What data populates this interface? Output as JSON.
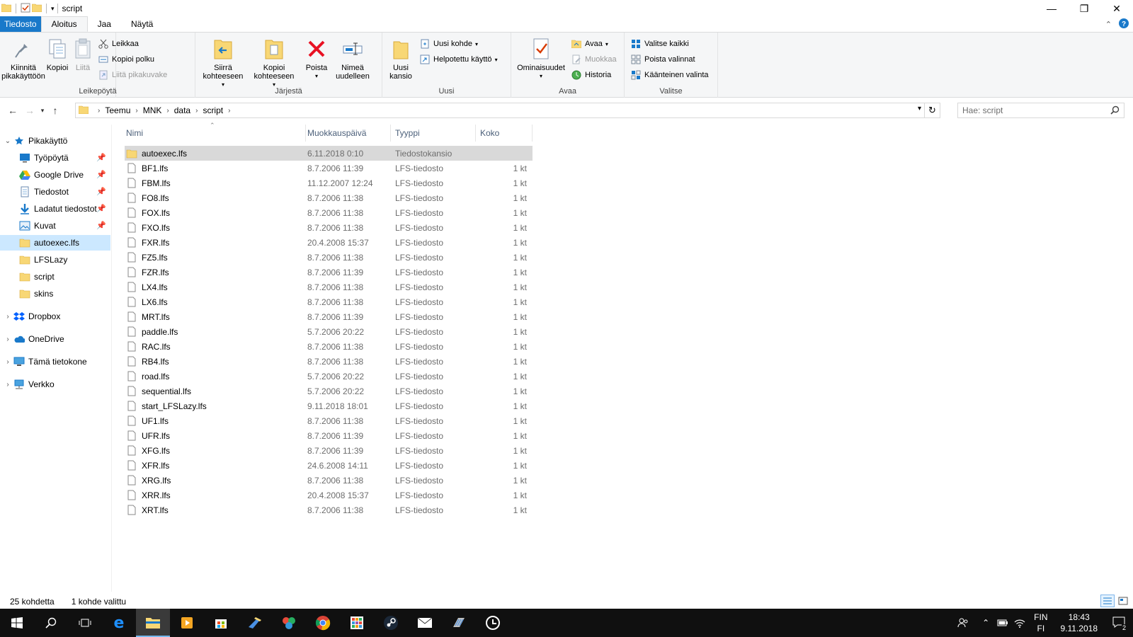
{
  "window": {
    "title": "script",
    "controls": {
      "minimize": "—",
      "restore": "❐",
      "close": "✕"
    }
  },
  "tabs": [
    {
      "label": "Tiedosto"
    },
    {
      "label": "Aloitus"
    },
    {
      "label": "Jaa"
    },
    {
      "label": "Näytä"
    }
  ],
  "ribbon": {
    "clipboard": {
      "label": "Leikepöytä",
      "pin": "Kiinnitä pikakäyttöön",
      "copy": "Kopioi",
      "paste": "Liitä",
      "cut": "Leikkaa",
      "copy_path": "Kopioi polku",
      "paste_shortcut": "Liitä pikakuvake"
    },
    "organize": {
      "label": "Järjestä",
      "move_to": "Siirrä kohteeseen",
      "copy_to": "Kopioi kohteeseen",
      "delete": "Poista",
      "rename": "Nimeä uudelleen"
    },
    "new": {
      "label": "Uusi",
      "new_folder": "Uusi kansio",
      "new_item": "Uusi kohde",
      "easy_access": "Helpotettu käyttö"
    },
    "open": {
      "label": "Avaa",
      "properties": "Ominaisuudet",
      "open": "Avaa",
      "edit": "Muokkaa",
      "history": "Historia"
    },
    "select": {
      "label": "Valitse",
      "select_all": "Valitse kaikki",
      "select_none": "Poista valinnat",
      "invert": "Käänteinen valinta"
    }
  },
  "address": {
    "crumbs": [
      "Teemu",
      "MNK",
      "data",
      "script"
    ],
    "search_placeholder": "Hae: script"
  },
  "nav": {
    "quick_access": "Pikakäyttö",
    "pinned": [
      {
        "label": "Työpöytä",
        "icon": "desktop-icon"
      },
      {
        "label": "Google Drive",
        "icon": "google-drive-icon"
      },
      {
        "label": "Tiedostot",
        "icon": "documents-icon"
      },
      {
        "label": "Ladatut tiedostot",
        "icon": "downloads-icon"
      },
      {
        "label": "Kuvat",
        "icon": "pictures-icon"
      }
    ],
    "recent": [
      {
        "label": "autoexec.lfs"
      },
      {
        "label": "LFSLazy"
      },
      {
        "label": "script"
      },
      {
        "label": "skins"
      }
    ],
    "roots": [
      {
        "label": "Dropbox"
      },
      {
        "label": "OneDrive"
      },
      {
        "label": "Tämä tietokone"
      },
      {
        "label": "Verkko"
      }
    ]
  },
  "columns": {
    "name": "Nimi",
    "modified": "Muokkauspäivä",
    "type": "Tyyppi",
    "size": "Koko"
  },
  "files": [
    {
      "name": "autoexec.lfs",
      "date": "6.11.2018 0:10",
      "type": "Tiedostokansio",
      "size": "",
      "folder": true
    },
    {
      "name": "BF1.lfs",
      "date": "8.7.2006 11:39",
      "type": "LFS-tiedosto",
      "size": "1 kt"
    },
    {
      "name": "FBM.lfs",
      "date": "11.12.2007 12:24",
      "type": "LFS-tiedosto",
      "size": "1 kt"
    },
    {
      "name": "FO8.lfs",
      "date": "8.7.2006 11:38",
      "type": "LFS-tiedosto",
      "size": "1 kt"
    },
    {
      "name": "FOX.lfs",
      "date": "8.7.2006 11:38",
      "type": "LFS-tiedosto",
      "size": "1 kt"
    },
    {
      "name": "FXO.lfs",
      "date": "8.7.2006 11:38",
      "type": "LFS-tiedosto",
      "size": "1 kt"
    },
    {
      "name": "FXR.lfs",
      "date": "20.4.2008 15:37",
      "type": "LFS-tiedosto",
      "size": "1 kt"
    },
    {
      "name": "FZ5.lfs",
      "date": "8.7.2006 11:38",
      "type": "LFS-tiedosto",
      "size": "1 kt"
    },
    {
      "name": "FZR.lfs",
      "date": "8.7.2006 11:39",
      "type": "LFS-tiedosto",
      "size": "1 kt"
    },
    {
      "name": "LX4.lfs",
      "date": "8.7.2006 11:38",
      "type": "LFS-tiedosto",
      "size": "1 kt"
    },
    {
      "name": "LX6.lfs",
      "date": "8.7.2006 11:38",
      "type": "LFS-tiedosto",
      "size": "1 kt"
    },
    {
      "name": "MRT.lfs",
      "date": "8.7.2006 11:39",
      "type": "LFS-tiedosto",
      "size": "1 kt"
    },
    {
      "name": "paddle.lfs",
      "date": "5.7.2006 20:22",
      "type": "LFS-tiedosto",
      "size": "1 kt"
    },
    {
      "name": "RAC.lfs",
      "date": "8.7.2006 11:38",
      "type": "LFS-tiedosto",
      "size": "1 kt"
    },
    {
      "name": "RB4.lfs",
      "date": "8.7.2006 11:38",
      "type": "LFS-tiedosto",
      "size": "1 kt"
    },
    {
      "name": "road.lfs",
      "date": "5.7.2006 20:22",
      "type": "LFS-tiedosto",
      "size": "1 kt"
    },
    {
      "name": "sequential.lfs",
      "date": "5.7.2006 20:22",
      "type": "LFS-tiedosto",
      "size": "1 kt"
    },
    {
      "name": "start_LFSLazy.lfs",
      "date": "9.11.2018 18:01",
      "type": "LFS-tiedosto",
      "size": "1 kt"
    },
    {
      "name": "UF1.lfs",
      "date": "8.7.2006 11:38",
      "type": "LFS-tiedosto",
      "size": "1 kt"
    },
    {
      "name": "UFR.lfs",
      "date": "8.7.2006 11:39",
      "type": "LFS-tiedosto",
      "size": "1 kt"
    },
    {
      "name": "XFG.lfs",
      "date": "8.7.2006 11:39",
      "type": "LFS-tiedosto",
      "size": "1 kt"
    },
    {
      "name": "XFR.lfs",
      "date": "24.6.2008 14:11",
      "type": "LFS-tiedosto",
      "size": "1 kt"
    },
    {
      "name": "XRG.lfs",
      "date": "8.7.2006 11:38",
      "type": "LFS-tiedosto",
      "size": "1 kt"
    },
    {
      "name": "XRR.lfs",
      "date": "20.4.2008 15:37",
      "type": "LFS-tiedosto",
      "size": "1 kt"
    },
    {
      "name": "XRT.lfs",
      "date": "8.7.2006 11:38",
      "type": "LFS-tiedosto",
      "size": "1 kt"
    }
  ],
  "status": {
    "count": "25 kohdetta",
    "selected": "1 kohde valittu"
  },
  "taskbar": {
    "lang_top": "FIN",
    "lang_bottom": "FI",
    "time": "18:43",
    "date": "9.11.2018",
    "notifications": "2"
  },
  "colors": {
    "accent": "#1979ca",
    "selection": "#cce8ff",
    "folder": "#f8d775",
    "delete": "#e81123"
  }
}
